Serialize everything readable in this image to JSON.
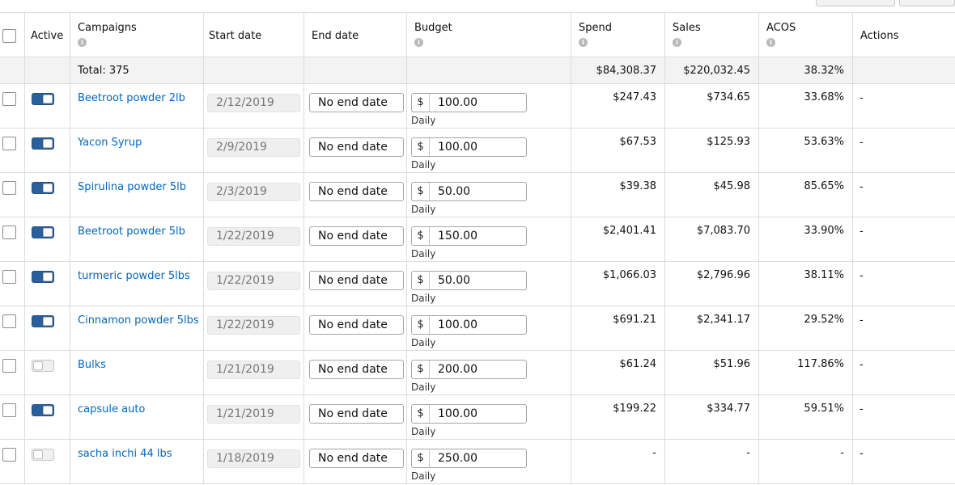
{
  "header": {
    "active": "Active",
    "campaigns": "Campaigns",
    "start_date": "Start date",
    "end_date": "End date",
    "budget": "Budget",
    "spend": "Spend",
    "sales": "Sales",
    "acos": "ACOS",
    "actions": "Actions",
    "info_icon": "info-icon"
  },
  "totals": {
    "label": "Total: 375",
    "spend": "$84,308.37",
    "sales": "$220,032.45",
    "acos": "38.32%"
  },
  "colors": {
    "link": "#0066c0",
    "toggle_on": "#2a5f9c",
    "total_row_bg": "#f3f3f3"
  },
  "rows": [
    {
      "active": true,
      "campaign": "Beetroot powder 2lb",
      "start": "2/12/2019",
      "end": "No end date",
      "currency": "$",
      "budget": "100.00",
      "budget_type": "Daily",
      "spend": "$247.43",
      "sales": "$734.65",
      "acos": "33.68%",
      "actions": "-"
    },
    {
      "active": true,
      "campaign": "Yacon Syrup",
      "start": "2/9/2019",
      "end": "No end date",
      "currency": "$",
      "budget": "100.00",
      "budget_type": "Daily",
      "spend": "$67.53",
      "sales": "$125.93",
      "acos": "53.63%",
      "actions": "-"
    },
    {
      "active": true,
      "campaign": "Spirulina powder 5lb",
      "start": "2/3/2019",
      "end": "No end date",
      "currency": "$",
      "budget": "50.00",
      "budget_type": "Daily",
      "spend": "$39.38",
      "sales": "$45.98",
      "acos": "85.65%",
      "actions": "-"
    },
    {
      "active": true,
      "campaign": "Beetroot powder 5lb",
      "start": "1/22/2019",
      "end": "No end date",
      "currency": "$",
      "budget": "150.00",
      "budget_type": "Daily",
      "spend": "$2,401.41",
      "sales": "$7,083.70",
      "acos": "33.90%",
      "actions": "-"
    },
    {
      "active": true,
      "campaign": "turmeric powder 5lbs",
      "start": "1/22/2019",
      "end": "No end date",
      "currency": "$",
      "budget": "50.00",
      "budget_type": "Daily",
      "spend": "$1,066.03",
      "sales": "$2,796.96",
      "acos": "38.11%",
      "actions": "-"
    },
    {
      "active": true,
      "campaign": "Cinnamon powder 5lbs",
      "start": "1/22/2019",
      "end": "No end date",
      "currency": "$",
      "budget": "100.00",
      "budget_type": "Daily",
      "spend": "$691.21",
      "sales": "$2,341.17",
      "acos": "29.52%",
      "actions": "-"
    },
    {
      "active": false,
      "campaign": "Bulks",
      "start": "1/21/2019",
      "end": "No end date",
      "currency": "$",
      "budget": "200.00",
      "budget_type": "Daily",
      "spend": "$61.24",
      "sales": "$51.96",
      "acos": "117.86%",
      "actions": "-"
    },
    {
      "active": true,
      "campaign": "capsule auto",
      "start": "1/21/2019",
      "end": "No end date",
      "currency": "$",
      "budget": "100.00",
      "budget_type": "Daily",
      "spend": "$199.22",
      "sales": "$334.77",
      "acos": "59.51%",
      "actions": "-"
    },
    {
      "active": false,
      "campaign": "sacha inchi 44 lbs",
      "start": "1/18/2019",
      "end": "No end date",
      "currency": "$",
      "budget": "250.00",
      "budget_type": "Daily",
      "spend": "-",
      "sales": "-",
      "acos": "-",
      "actions": "-"
    }
  ]
}
